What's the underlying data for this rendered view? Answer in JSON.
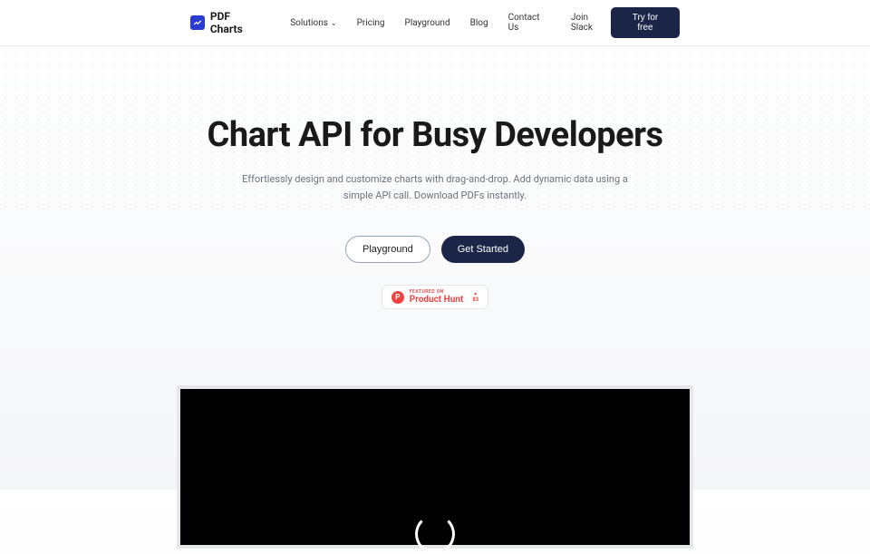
{
  "brand": {
    "name": "PDF Charts"
  },
  "nav": {
    "items": [
      {
        "label": "Solutions",
        "hasDropdown": true
      },
      {
        "label": "Pricing",
        "hasDropdown": false
      },
      {
        "label": "Playground",
        "hasDropdown": false
      },
      {
        "label": "Blog",
        "hasDropdown": false
      },
      {
        "label": "Contact Us",
        "hasDropdown": false
      },
      {
        "label": "Join Slack",
        "hasDropdown": false
      }
    ],
    "cta": "Try for free"
  },
  "hero": {
    "title": "Chart API for Busy Developers",
    "subtitle": "Effortlessly design and customize charts with drag-and-drop. Add dynamic data using a simple API call. Download PDFs instantly.",
    "buttons": {
      "secondary": "Playground",
      "primary": "Get Started"
    },
    "productHunt": {
      "featuredLabel": "FEATURED ON",
      "name": "Product Hunt",
      "upvotes": "83"
    }
  }
}
